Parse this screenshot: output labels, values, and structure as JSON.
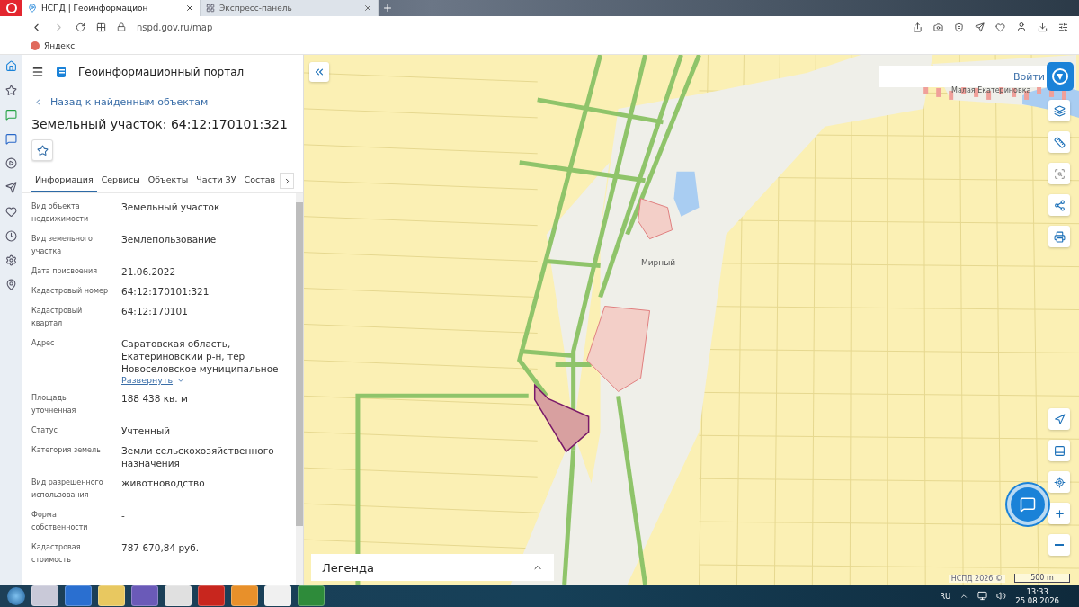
{
  "browser": {
    "tabs": [
      {
        "title": "НСПД | Геоинформацион",
        "selected": true
      },
      {
        "title": "Экспресс-панель",
        "selected": false
      }
    ],
    "address": "nspd.gov.ru/map",
    "bookmarks": [
      "Яндекс"
    ]
  },
  "portal": {
    "title": "Геоинформационный портал",
    "back_link": "Назад к найденным объектам",
    "heading": "Земельный участок: 64:12:170101:321",
    "tabs": [
      {
        "label": "Информация",
        "selected": true
      },
      {
        "label": "Сервисы",
        "selected": false
      },
      {
        "label": "Объекты",
        "selected": false
      },
      {
        "label": "Части ЗУ",
        "selected": false
      },
      {
        "label": "Состав",
        "selected": false
      }
    ],
    "fields": [
      {
        "label": "Вид объекта недвижимости",
        "value": "Земельный участок"
      },
      {
        "label": "Вид земельного участка",
        "value": "Землепользование"
      },
      {
        "label": "Дата присвоения",
        "value": "21.06.2022"
      },
      {
        "label": "Кадастровый номер",
        "value": "64:12:170101:321"
      },
      {
        "label": "Кадастровый квартал",
        "value": "64:12:170101"
      },
      {
        "label": "Адрес",
        "value": "Саратовская область, Екатериновский р-н, тер Новоселовское муниципальное",
        "expand_link": "Развернуть"
      },
      {
        "label": "Площадь уточненная",
        "value": "188 438 кв. м"
      },
      {
        "label": "Статус",
        "value": "Учтенный"
      },
      {
        "label": "Категория земель",
        "value": "Земли сельскохозяйственного назначения"
      },
      {
        "label": "Вид разрешенного использования",
        "value": "животноводство"
      },
      {
        "label": "Форма собственности",
        "value": "-"
      },
      {
        "label": "Кадастровая стоимость",
        "value": "787 670,84 руб."
      }
    ]
  },
  "map": {
    "login_button": "Войти",
    "settlement_labels": [
      {
        "text": "Малая Екатериновка"
      },
      {
        "text": "Мирный"
      }
    ],
    "legend": "Легенда",
    "attribution": "НСПД 2026 ©",
    "scale": "500 m"
  },
  "taskbar": {
    "language": "RU",
    "time": "13:33",
    "date": "25.08.2026"
  }
}
